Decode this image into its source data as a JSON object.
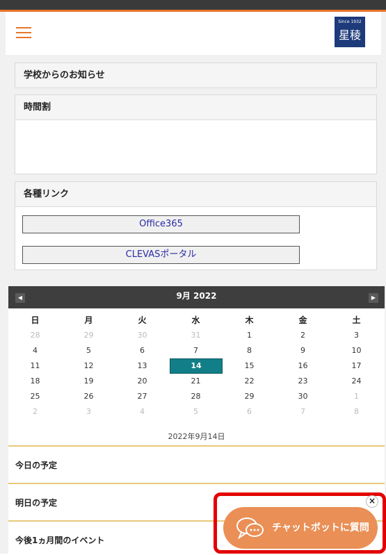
{
  "header": {
    "logo_since": "Since 1932",
    "logo_name": "星稜"
  },
  "panels": {
    "news_title": "学校からのお知らせ",
    "timetable_title": "時間割",
    "links_title": "各種リンク",
    "links": [
      "Office365",
      "CLEVASポータル"
    ]
  },
  "calendar": {
    "title": "9月 2022",
    "prev_label": "◀",
    "next_label": "▶",
    "weekdays": [
      "日",
      "月",
      "火",
      "水",
      "木",
      "金",
      "土"
    ],
    "weeks": [
      [
        "28",
        "29",
        "30",
        "31",
        "1",
        "2",
        "3"
      ],
      [
        "4",
        "5",
        "6",
        "7",
        "8",
        "9",
        "10"
      ],
      [
        "11",
        "12",
        "13",
        "14",
        "15",
        "16",
        "17"
      ],
      [
        "18",
        "19",
        "20",
        "21",
        "22",
        "23",
        "24"
      ],
      [
        "25",
        "26",
        "27",
        "28",
        "29",
        "30",
        "1"
      ],
      [
        "2",
        "3",
        "4",
        "5",
        "6",
        "7",
        "8"
      ]
    ],
    "selected_date_label": "2022年9月14日"
  },
  "schedule": {
    "today": "今日の予定",
    "tomorrow": "明日の予定",
    "month": "今後1ヵ月間のイベント"
  },
  "chatbot": {
    "label": "チャットボットに質問",
    "close_label": "×"
  },
  "colors": {
    "accent": "#e8742a",
    "today": "#127f88",
    "chat": "#ea8f55",
    "highlight": "#e30000"
  }
}
